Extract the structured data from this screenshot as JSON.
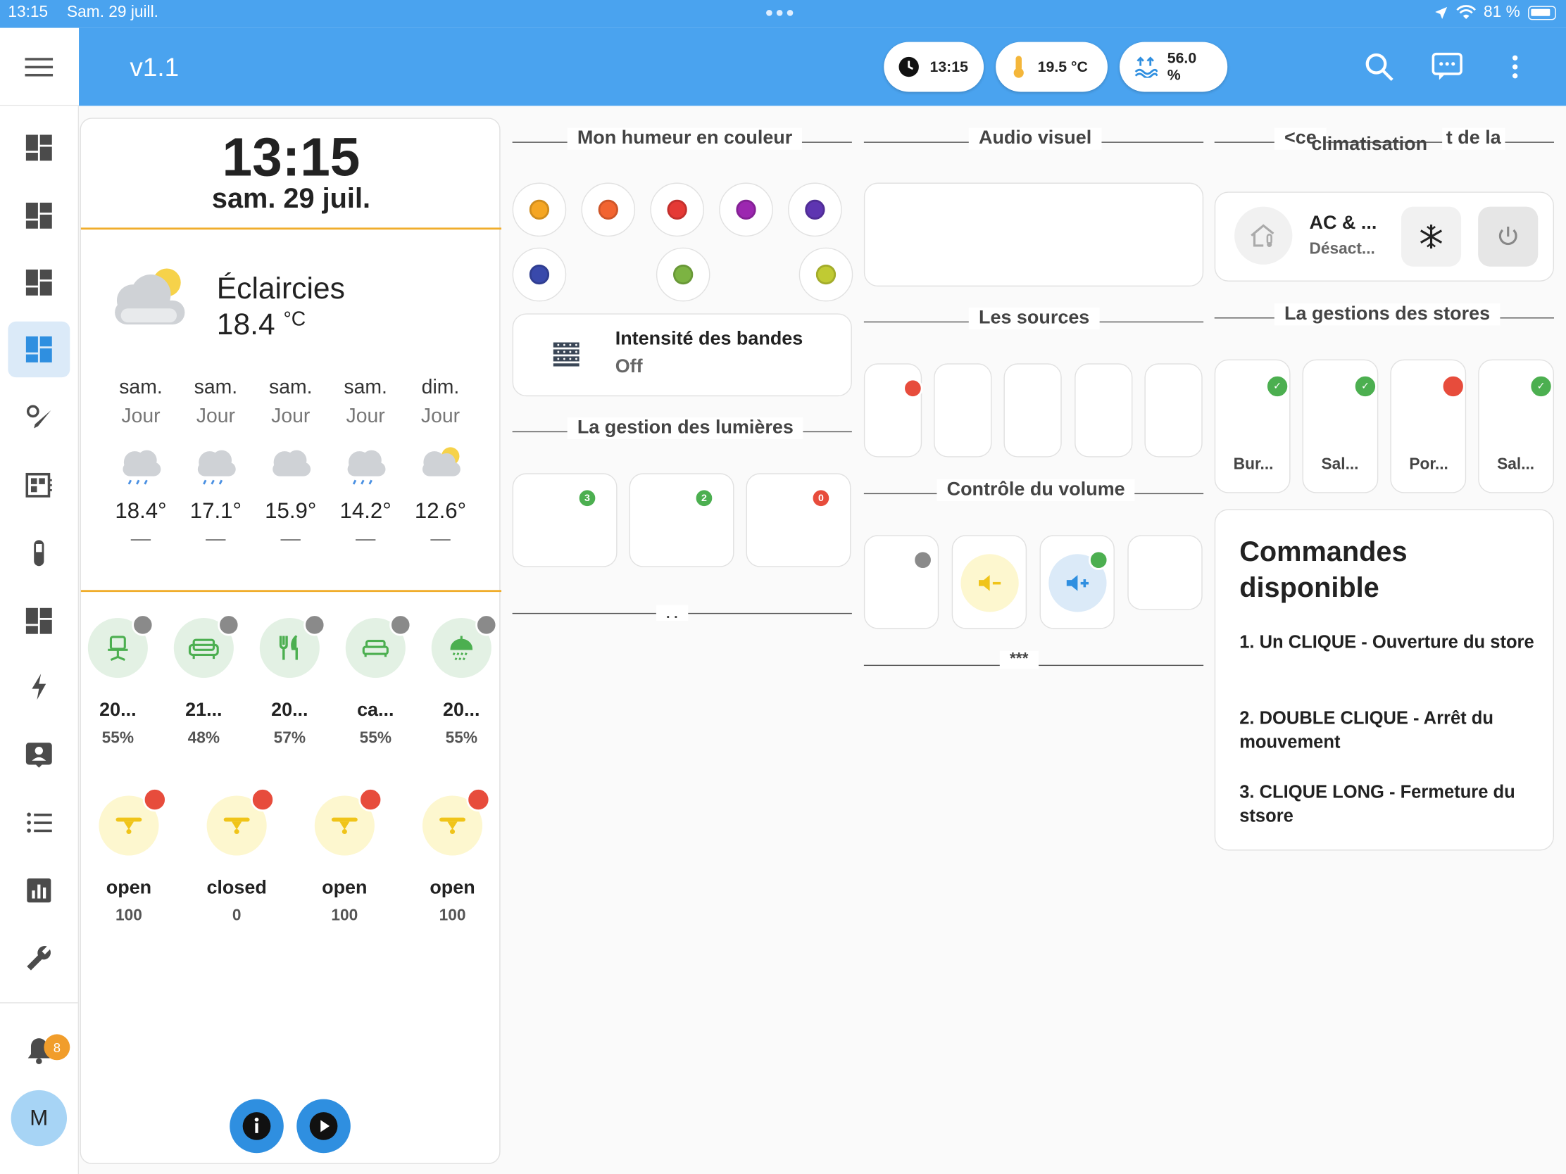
{
  "status_bar": {
    "time": "13:15",
    "date": "Sam. 29 juill.",
    "battery": "81 %"
  },
  "header": {
    "version": "v1.1",
    "pills": [
      {
        "icon": "clock-icon",
        "value": "13:15"
      },
      {
        "icon": "thermometer-icon",
        "value": "19.5 °C"
      },
      {
        "icon": "humidity-icon",
        "value": "56.0 %"
      }
    ]
  },
  "sidebar": {
    "notification_count": "8",
    "avatar_letter": "M"
  },
  "clock": {
    "time": "13:15",
    "date": "sam. 29 juil."
  },
  "weather": {
    "condition": "Éclaircies",
    "temperature": "18.4",
    "unit": "°C",
    "forecast": [
      {
        "day": "sam.",
        "period": "Jour",
        "temp": "18.4°",
        "extra": "—",
        "icon": "rainy-cloud-icon"
      },
      {
        "day": "sam.",
        "period": "Jour",
        "temp": "17.1°",
        "extra": "—",
        "icon": "rainy-cloud-icon"
      },
      {
        "day": "sam.",
        "period": "Jour",
        "temp": "15.9°",
        "extra": "—",
        "icon": "cloud-icon"
      },
      {
        "day": "sam.",
        "period": "Jour",
        "temp": "14.2°",
        "extra": "—",
        "icon": "rainy-cloud-icon"
      },
      {
        "day": "dim.",
        "period": "Jour",
        "temp": "12.6°",
        "extra": "—",
        "icon": "partly-cloudy-icon"
      }
    ]
  },
  "rooms": [
    {
      "name": "20...",
      "value": "55%",
      "icon": "desk-chair-icon"
    },
    {
      "name": "21...",
      "value": "48%",
      "icon": "sofa-icon"
    },
    {
      "name": "20...",
      "value": "57%",
      "icon": "fork-knife-icon"
    },
    {
      "name": "ca...",
      "value": "55%",
      "icon": "bed-icon"
    },
    {
      "name": "20...",
      "value": "55%",
      "icon": "shower-icon"
    }
  ],
  "covers": [
    {
      "state": "open",
      "value": "100"
    },
    {
      "state": "closed",
      "value": "0"
    },
    {
      "state": "open",
      "value": "100"
    },
    {
      "state": "open",
      "value": "100"
    }
  ],
  "sections": {
    "mood": "Mon humeur en couleur",
    "audio": "Audio visuel",
    "clim": "climatisation",
    "clim_fragment_left": "<ce",
    "clim_fragment_right": "t de la",
    "sources": "Les sources",
    "stores": "La gestions des stores",
    "lights": "La gestion des lumières",
    "volume": "Contrôle du volume",
    "dots": ". .",
    "stars": "***"
  },
  "mood_colors": [
    "#f5a623",
    "#f26430",
    "#e53935",
    "#9c27b0",
    "#5e35b1",
    "#3949ab",
    "#7cb342",
    "#c0ca33"
  ],
  "strip": {
    "title": "Intensité des bandes",
    "state": "Off"
  },
  "light_badges": [
    "3",
    "2",
    "0"
  ],
  "ac": {
    "name": "AC & ...",
    "state": "Désact..."
  },
  "stores": [
    {
      "name": "Bur...",
      "status": "ok"
    },
    {
      "name": "Sal...",
      "status": "ok"
    },
    {
      "name": "Por...",
      "status": "alert"
    },
    {
      "name": "Sal...",
      "status": "ok"
    }
  ],
  "commands": {
    "title": "Commandes disponible",
    "items": [
      "1. Un CLIQUE - Ouverture du store",
      "2. DOUBLE CLIQUE - Arrêt du mouvement",
      "3. CLIQUE LONG - Fermeture du stsore"
    ]
  }
}
